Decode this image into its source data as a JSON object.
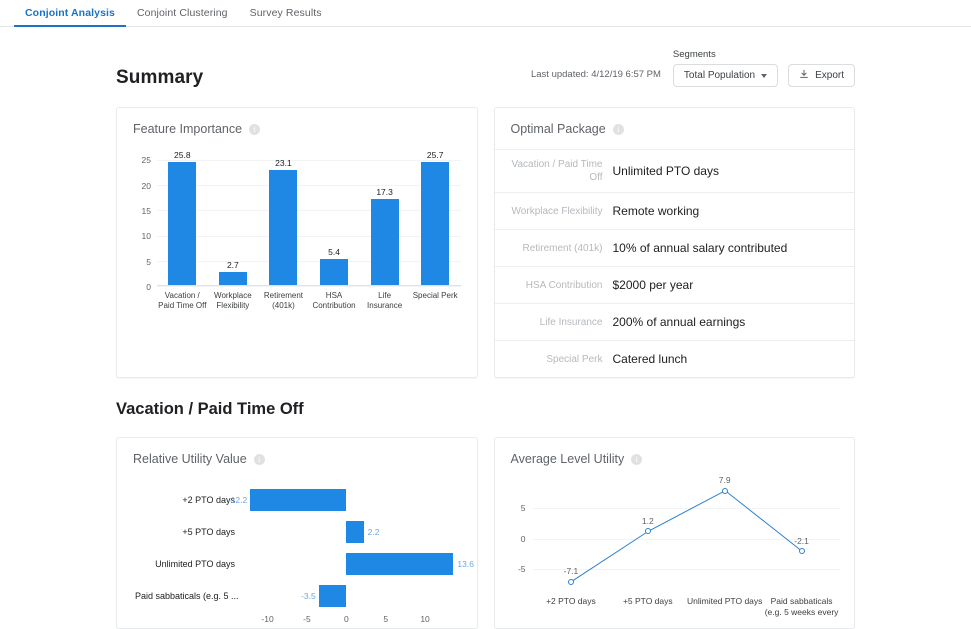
{
  "nav": {
    "tabs": [
      {
        "label": "Conjoint Analysis",
        "active": true
      },
      {
        "label": "Conjoint Clustering",
        "active": false
      },
      {
        "label": "Survey Results",
        "active": false
      }
    ]
  },
  "header": {
    "title": "Summary",
    "last_updated": "Last updated: 4/12/19 6:57 PM",
    "segments_label": "Segments",
    "segment_value": "Total Population",
    "export_label": "Export"
  },
  "feature_importance": {
    "title": "Feature Importance",
    "info_glyph": "i"
  },
  "optimal_package": {
    "title": "Optimal Package",
    "info_glyph": "i",
    "rows": [
      {
        "key": "Vacation / Paid Time Off",
        "value": "Unlimited PTO days"
      },
      {
        "key": "Workplace Flexibility",
        "value": "Remote working"
      },
      {
        "key": "Retirement (401k)",
        "value": "10% of annual salary contributed"
      },
      {
        "key": "HSA Contribution",
        "value": "$2000 per year"
      },
      {
        "key": "Life Insurance",
        "value": "200% of annual earnings"
      },
      {
        "key": "Special Perk",
        "value": "Catered lunch"
      }
    ]
  },
  "section": {
    "title": "Vacation / Paid Time Off"
  },
  "relative_utility": {
    "title": "Relative Utility Value",
    "info_glyph": "i"
  },
  "average_level_utility": {
    "title": "Average Level Utility",
    "info_glyph": "i"
  },
  "colors": {
    "bar_blue": "#1f88e5",
    "line_blue": "#2b7fd0",
    "accent": "#1a73c7",
    "value_label_blue": "#68a9e8"
  },
  "chart_data": [
    {
      "type": "bar",
      "title": "Feature Importance",
      "categories": [
        "Vacation / Paid Time Off",
        "Workplace Flexibility",
        "Retirement (401k)",
        "HSA Contribution",
        "Life Insurance",
        "Special Perk"
      ],
      "values": [
        25.8,
        2.7,
        23.1,
        5.4,
        17.3,
        25.7
      ],
      "xlabel": "",
      "ylabel": "",
      "ylim": [
        0,
        27
      ],
      "yticks": [
        0,
        5,
        10,
        15,
        20,
        25
      ],
      "grid": true,
      "legend": "none"
    },
    {
      "type": "bar",
      "orientation": "horizontal",
      "title": "Relative Utility Value",
      "categories": [
        "+2 PTO days",
        "+5 PTO days",
        "Unlimited PTO days",
        "Paid sabbaticals (e.g. 5 ..."
      ],
      "values": [
        -12.2,
        2.2,
        13.6,
        -3.5
      ],
      "xlabel": "",
      "ylabel": "",
      "xlim": [
        -13.5,
        14.5
      ],
      "xticks": [
        -10,
        -5,
        0,
        5,
        10
      ],
      "grid": false,
      "legend": "none"
    },
    {
      "type": "line",
      "title": "Average Level Utility",
      "x": [
        "+2 PTO days",
        "+5 PTO days",
        "Unlimited PTO days",
        "Paid sabbaticals (e.g. 5 weeks every"
      ],
      "values": [
        -7.1,
        1.2,
        7.9,
        -2.1
      ],
      "xlabel": "",
      "ylabel": "",
      "ylim": [
        -8.5,
        9
      ],
      "yticks": [
        -5,
        0,
        5
      ],
      "grid": true,
      "markers": "open-circle",
      "legend": "none"
    }
  ]
}
